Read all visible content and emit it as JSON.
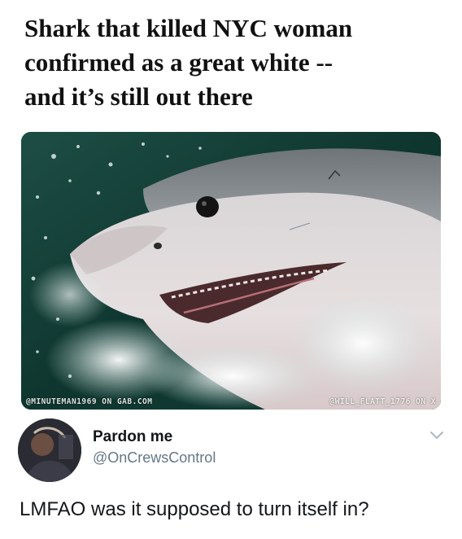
{
  "headline": {
    "line1": "Shark that killed NYC woman",
    "line2": "confirmed as a great white --",
    "line3": "and it’s still out there"
  },
  "photo": {
    "watermark_left": "@MINUTEMAN1969 ON GAB.COM",
    "watermark_right": "@WILL_FLATT_1776 ON X"
  },
  "tweet": {
    "display_name": "Pardon me",
    "handle": "@OnCrewsControl",
    "text": "LMFAO was it supposed to turn itself in?",
    "menu_icon": "chevron-down-icon"
  },
  "colors": {
    "text": "#14171a",
    "secondary": "#657786",
    "water": "#0f3a33"
  }
}
